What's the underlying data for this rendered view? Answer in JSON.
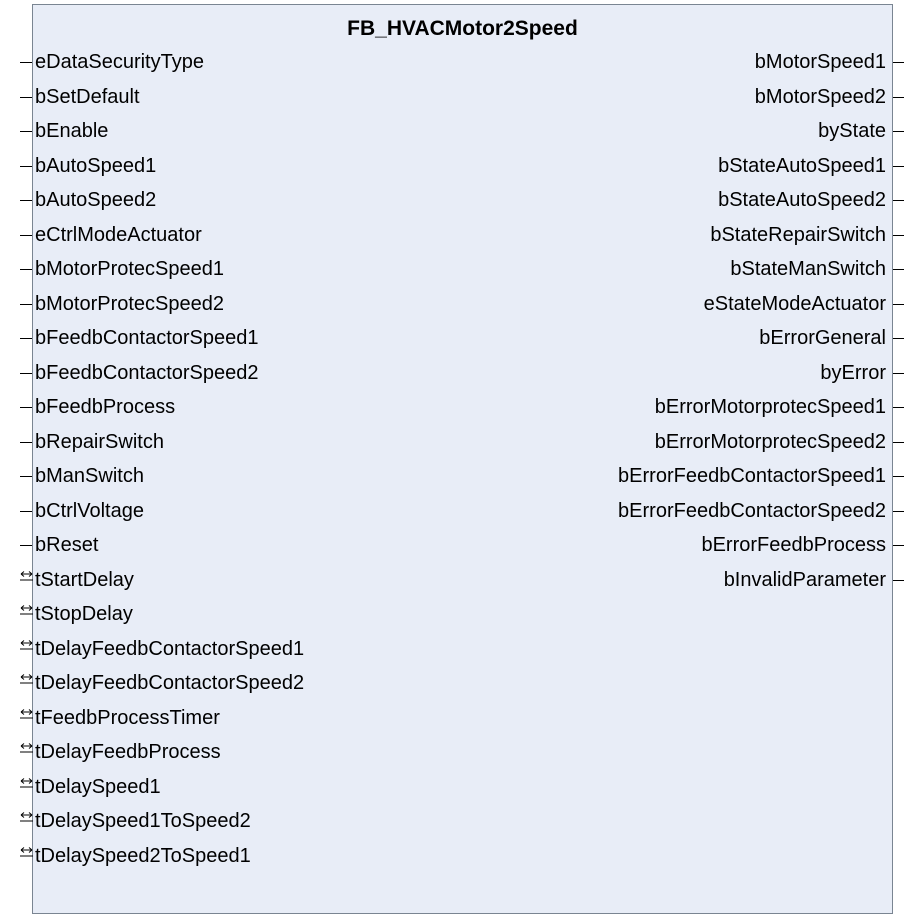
{
  "block": {
    "title": "FB_HVACMotor2Speed"
  },
  "inputs": [
    "eDataSecurityType",
    "bSetDefault",
    "bEnable",
    "bAutoSpeed1",
    "bAutoSpeed2",
    "eCtrlModeActuator",
    "bMotorProtecSpeed1",
    "bMotorProtecSpeed2",
    "bFeedbContactorSpeed1",
    "bFeedbContactorSpeed2",
    "bFeedbProcess",
    "bRepairSwitch",
    "bManSwitch",
    "bCtrlVoltage",
    "bReset"
  ],
  "inouts": [
    "tStartDelay",
    "tStopDelay",
    "tDelayFeedbContactorSpeed1",
    "tDelayFeedbContactorSpeed2",
    "tFeedbProcessTimer",
    "tDelayFeedbProcess",
    "tDelaySpeed1",
    "tDelaySpeed1ToSpeed2",
    "tDelaySpeed2ToSpeed1"
  ],
  "outputs": [
    "bMotorSpeed1",
    "bMotorSpeed2",
    "byState",
    "bStateAutoSpeed1",
    "bStateAutoSpeed2",
    "bStateRepairSwitch",
    "bStateManSwitch",
    "eStateModeActuator",
    "bErrorGeneral",
    "byError",
    "bErrorMotorprotecSpeed1",
    "bErrorMotorprotecSpeed2",
    "bErrorFeedbContactorSpeed1",
    "bErrorFeedbContactorSpeed2",
    "bErrorFeedbProcess",
    "bInvalidParameter"
  ]
}
